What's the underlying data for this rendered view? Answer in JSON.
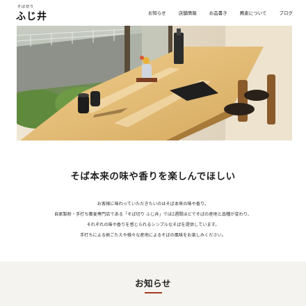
{
  "header": {
    "logo_small": "そば切り",
    "logo_big": "ふじ井",
    "nav": [
      "お知らせ",
      "店舗情報",
      "お品書き",
      "蕎麦について",
      "ブログ"
    ]
  },
  "intro": {
    "title": "そば本来の味や香りを楽しんでほしい",
    "lines": [
      "お客様に味わっていただきたいのはそば本来の味や香り。",
      "自家製粉・手打ち蕎麦専門店である「そば切り ふじ井」では2週間ほどでそばの産地と品種が変わり、",
      "それぞれの味や香りを感じられるシンプルなそばを提供しています。",
      "手打ちによる歯ごたえや様々な産地によるそばの風味をお楽しみください。"
    ]
  },
  "news": {
    "title": "お知らせ"
  },
  "colors": {
    "accent": "#a43a1f",
    "news_bg": "#f5f3ef"
  }
}
